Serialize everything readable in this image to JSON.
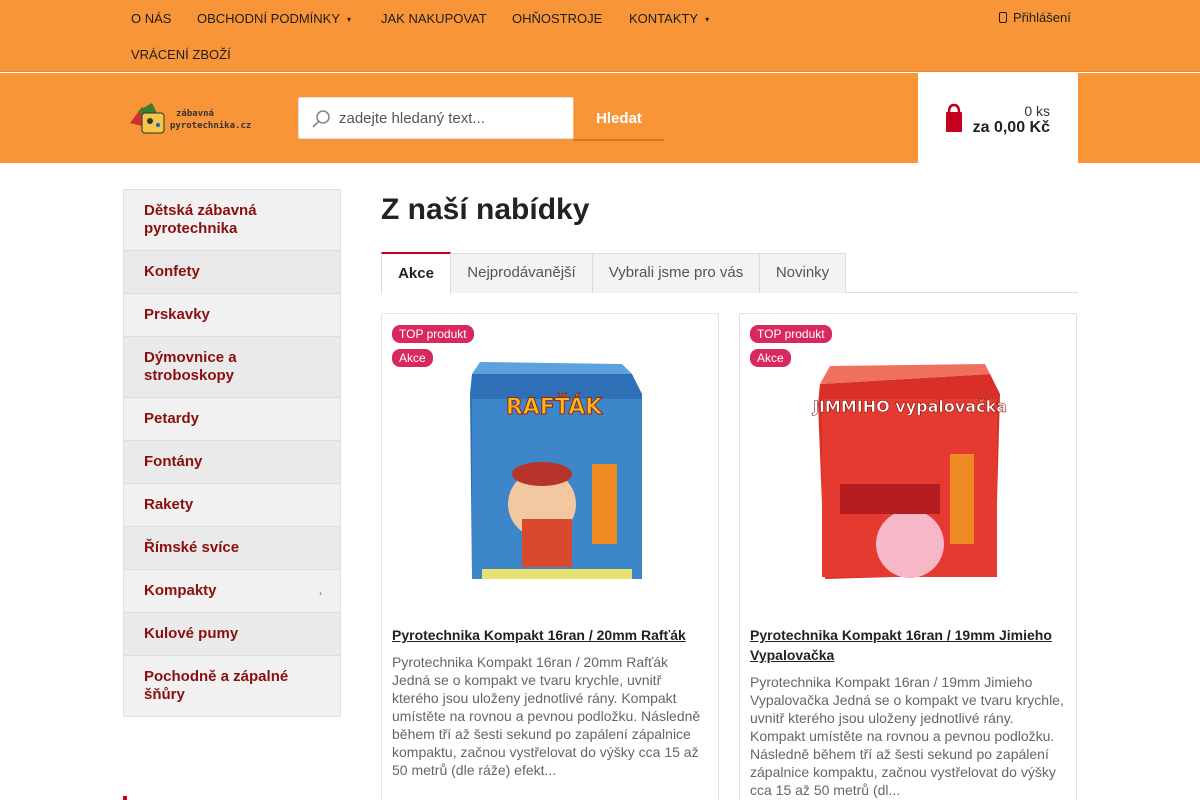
{
  "nav": {
    "items": [
      {
        "label": "O NÁS"
      },
      {
        "label": "OBCHODNÍ PODMÍNKY",
        "dropdown": true
      },
      {
        "label": "JAK NAKUPOVAT"
      },
      {
        "label": "OHŇOSTROJE"
      },
      {
        "label": "KONTAKTY",
        "dropdown": true
      },
      {
        "label": "VRÁCENÍ ZBOŽÍ"
      }
    ],
    "login_label": "Přihlášení"
  },
  "header": {
    "logo_text_line1": "zábavná",
    "logo_text_line2": "pyrotechnika.cz",
    "search_placeholder": "zadejte hledaný text...",
    "search_button": "Hledat",
    "cart_count": "0 ks",
    "cart_total": "za 0,00 Kč"
  },
  "sidebar": {
    "items": [
      {
        "label": "Dětská zábavná pyrotechnika"
      },
      {
        "label": "Konfety"
      },
      {
        "label": "Prskavky"
      },
      {
        "label": "Dýmovnice a stroboskopy"
      },
      {
        "label": "Petardy"
      },
      {
        "label": "Fontány"
      },
      {
        "label": "Rakety"
      },
      {
        "label": "Římské svíce"
      },
      {
        "label": "Kompakty",
        "has_submenu": true
      },
      {
        "label": "Kulové pumy"
      },
      {
        "label": "Pochodně a zápalné šňůry"
      }
    ]
  },
  "main": {
    "title": "Z naší nabídky",
    "tabs": [
      {
        "label": "Akce",
        "active": true
      },
      {
        "label": "Nejprodávanější"
      },
      {
        "label": "Vybrali jsme pro vás"
      },
      {
        "label": "Novinky"
      }
    ],
    "products": [
      {
        "badge_top": "TOP produkt",
        "badge_sale": "Akce",
        "image_text": "RAFŤÁK",
        "name": "Pyrotechnika Kompakt 16ran / 20mm Rafťák",
        "description": "Pyrotechnika Kompakt 16ran / 20mm Rafťák Jedná se o kompakt ve tvaru krychle, uvnitř kterého jsou uloženy jednotlivé rány. Kompakt umístěte na rovnou a pevnou podložku. Následně během tří až šesti sekund po zapálení zápalnice kompaktu,  začnou vystřelovat do výšky cca 15 až 50 metrů (dle ráže) efekt..."
      },
      {
        "badge_top": "TOP produkt",
        "badge_sale": "Akce",
        "image_text": "JIMMIHO vypalovačka",
        "name": "Pyrotechnika Kompakt 16ran / 19mm Jimieho Vypalovačka",
        "description": "Pyrotechnika Kompakt 16ran / 19mm Jimieho Vypalovačka Jedná se o kompakt ve tvaru krychle, uvnitř kterého jsou uloženy jednotlivé rány. Kompakt umístěte na rovnou a pevnou podložku. Následně během tří až šesti sekund po zapálení zápalnice kompaktu,  začnou vystřelovat do výšky cca 15 až 50 metrů (dl..."
      }
    ]
  },
  "colors": {
    "brand_orange": "#f79538",
    "accent_red": "#c4001c",
    "badge_pink": "#d8295e",
    "sidebar_link": "#8a1010"
  }
}
